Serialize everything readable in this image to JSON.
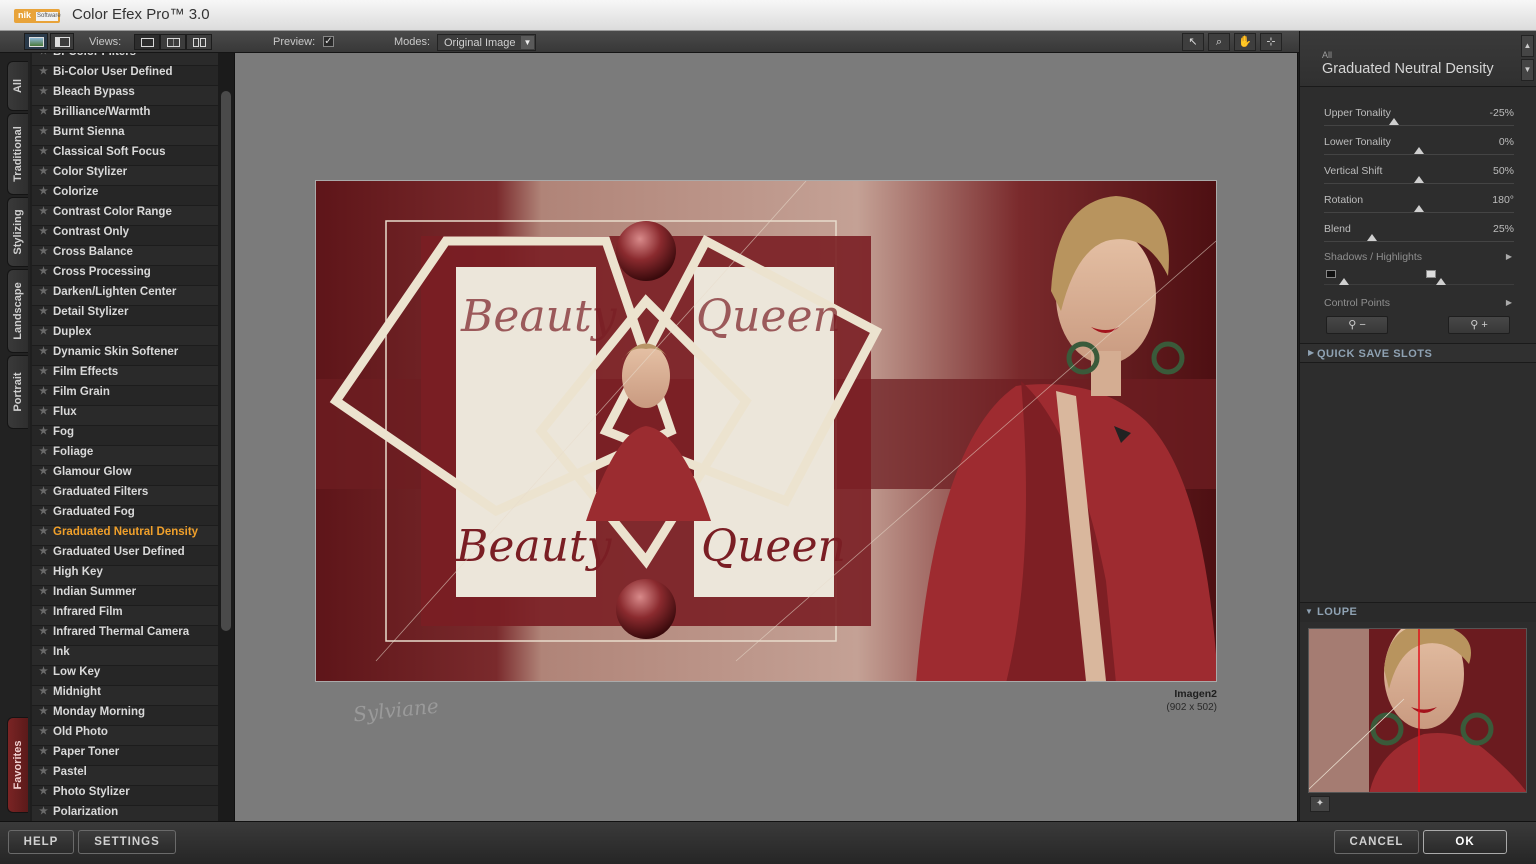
{
  "app": {
    "title": "Color Efex Pro™ 3.0",
    "logo_text": "nik",
    "logo_sub": "Software"
  },
  "toolbar": {
    "views_label": "Views:",
    "preview_label": "Preview:",
    "preview_checked": true,
    "modes_label": "Modes:",
    "modes_value": "Original Image"
  },
  "left_tabs": [
    "All",
    "Traditional",
    "Stylizing",
    "Landscape",
    "Portrait",
    "Favorites"
  ],
  "filters": {
    "partial_top": "Bi-Color Filters",
    "items": [
      "Bi-Color User Defined",
      "Bleach Bypass",
      "Brilliance/Warmth",
      "Burnt Sienna",
      "Classical Soft Focus",
      "Color Stylizer",
      "Colorize",
      "Contrast Color Range",
      "Contrast Only",
      "Cross Balance",
      "Cross Processing",
      "Darken/Lighten Center",
      "Detail Stylizer",
      "Duplex",
      "Dynamic Skin Softener",
      "Film Effects",
      "Film Grain",
      "Flux",
      "Fog",
      "Foliage",
      "Glamour Glow",
      "Graduated Filters",
      "Graduated Fog",
      "Graduated Neutral Density",
      "Graduated User Defined",
      "High Key",
      "Indian Summer",
      "Infrared Film",
      "Infrared Thermal Camera",
      "Ink",
      "Low Key",
      "Midnight",
      "Monday Morning",
      "Old Photo",
      "Paper Toner",
      "Pastel",
      "Photo Stylizer",
      "Polarization"
    ],
    "selected": "Graduated Neutral Density"
  },
  "canvas": {
    "image_name": "Imagen2",
    "image_size": "(902 x 502)",
    "art_words": [
      "Beauty",
      "Queen"
    ],
    "signature": "Sylviane"
  },
  "panel": {
    "category": "All",
    "filter_name": "Graduated Neutral Density",
    "sliders": [
      {
        "label": "Upper Tonality",
        "value": "-25%",
        "pos": 0.37
      },
      {
        "label": "Lower Tonality",
        "value": "0%",
        "pos": 0.5
      },
      {
        "label": "Vertical Shift",
        "value": "50%",
        "pos": 0.5
      },
      {
        "label": "Rotation",
        "value": "180°",
        "pos": 0.5
      },
      {
        "label": "Blend",
        "value": "25%",
        "pos": 0.25
      }
    ],
    "shadows_highlights_label": "Shadows / Highlights",
    "control_points_label": "Control Points",
    "quick_save_label": "QUICK SAVE SLOTS",
    "loupe_label": "LOUPE"
  },
  "bottom": {
    "help": "HELP",
    "settings": "SETTINGS",
    "cancel": "CANCEL",
    "ok": "OK"
  },
  "colors": {
    "selected_filter": "#f0a02b",
    "section_header": "#8fa2b3",
    "art_maroon": "#6b1b1f"
  }
}
